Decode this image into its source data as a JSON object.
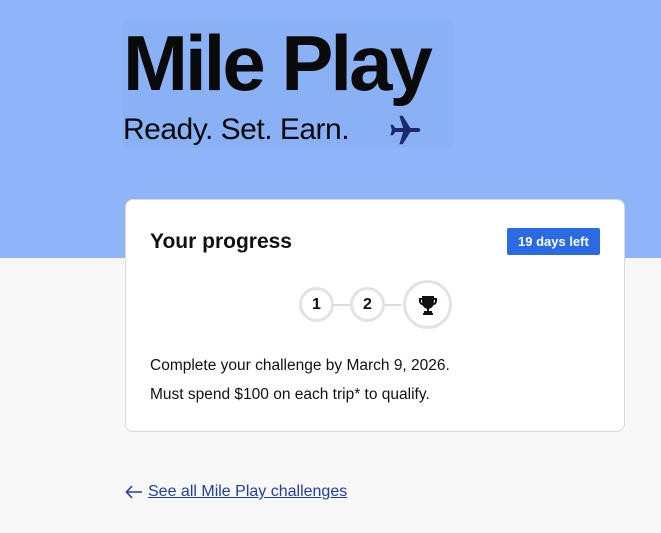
{
  "brand": {
    "title": "Mile Play",
    "tagline": "Ready. Set. Earn."
  },
  "progress": {
    "title": "Your progress",
    "badge": "19 days left",
    "steps": [
      "1",
      "2"
    ],
    "line1": "Complete your challenge by March 9, 2026.",
    "line2": "Must spend $100 on each trip* to qualify."
  },
  "nav": {
    "back_label": "See all Mile Play challenges"
  },
  "colors": {
    "hero": "#8fb4f8",
    "badge": "#2a6ae3",
    "link": "#1f3f9e",
    "plane": "#1c2a6b"
  },
  "icons": [
    "plane-icon",
    "trophy-icon",
    "arrow-left-icon"
  ]
}
